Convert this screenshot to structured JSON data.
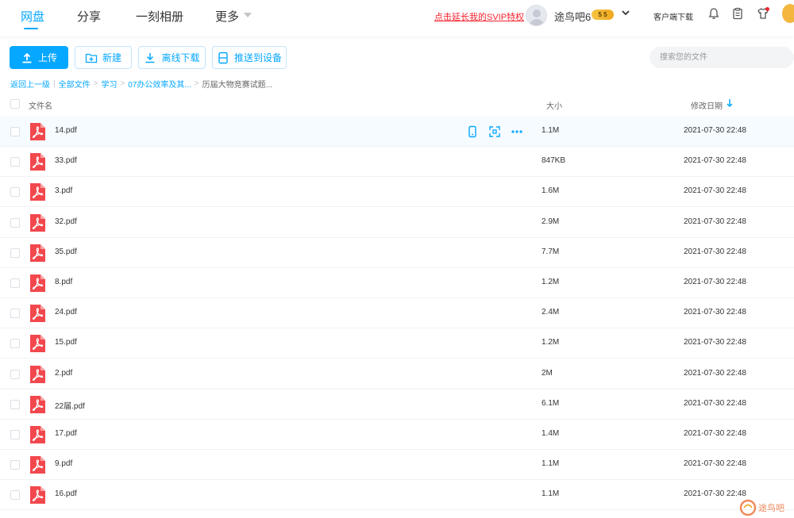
{
  "nav": {
    "items": [
      {
        "label": "网盘",
        "active": true
      },
      {
        "label": "分享",
        "active": false
      },
      {
        "label": "一刻相册",
        "active": false
      },
      {
        "label": "更多",
        "active": false
      }
    ],
    "svip_link": "点击延长我的SVIP特权",
    "username": "途鸟吧6",
    "vip_badge": "5  5",
    "client_download": "客户端下载",
    "accent_color": "#06a7ff"
  },
  "toolbar": {
    "upload": "上传",
    "new": "新建",
    "offline_download": "离线下载",
    "push_device": "推送到设备",
    "search_placeholder": "搜索您的文件"
  },
  "breadcrumb": {
    "back": "返回上一级",
    "items": [
      "全部文件",
      "学习",
      "07办公效率及其...",
      "历届大物竞赛试题..."
    ]
  },
  "table": {
    "headers": {
      "name": "文件名",
      "size": "大小",
      "date": "修改日期"
    },
    "rows": [
      {
        "name": "14.pdf",
        "size": "1.1M",
        "date": "2021-07-30 22:48"
      },
      {
        "name": "33.pdf",
        "size": "847KB",
        "date": "2021-07-30 22:48"
      },
      {
        "name": "3.pdf",
        "size": "1.6M",
        "date": "2021-07-30 22:48"
      },
      {
        "name": "32.pdf",
        "size": "2.9M",
        "date": "2021-07-30 22:48"
      },
      {
        "name": "35.pdf",
        "size": "7.7M",
        "date": "2021-07-30 22:48"
      },
      {
        "name": "8.pdf",
        "size": "1.2M",
        "date": "2021-07-30 22:48"
      },
      {
        "name": "24.pdf",
        "size": "2.4M",
        "date": "2021-07-30 22:48"
      },
      {
        "name": "15.pdf",
        "size": "1.2M",
        "date": "2021-07-30 22:48"
      },
      {
        "name": "2.pdf",
        "size": "2M",
        "date": "2021-07-30 22:48"
      },
      {
        "name": "22届.pdf",
        "size": "6.1M",
        "date": "2021-07-30 22:48"
      },
      {
        "name": "17.pdf",
        "size": "1.4M",
        "date": "2021-07-30 22:48"
      },
      {
        "name": "9.pdf",
        "size": "1.1M",
        "date": "2021-07-30 22:48"
      },
      {
        "name": "16.pdf",
        "size": "1.1M",
        "date": "2021-07-30 22:48"
      }
    ]
  },
  "watermark": "途鸟吧"
}
